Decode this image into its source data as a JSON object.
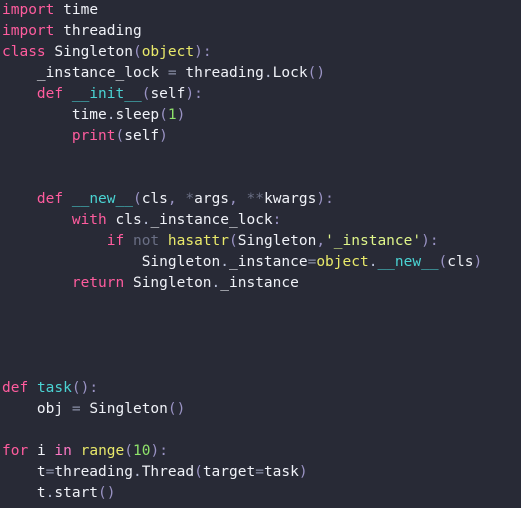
{
  "editor": {
    "language": "Python",
    "theme": "dracula-dark",
    "background_color": "#282a36",
    "font_size_px": 14.5,
    "line_height_px": 21,
    "total_lines": 24
  },
  "colors": {
    "keyword": "#ff5c9e",
    "keyword_in": "#ff79c6",
    "soft_keyword": "#6a6f85",
    "identifier": "#f0f2f8",
    "builtin": "#e9e96a",
    "function_name": "#4ad3d3",
    "number": "#8fe36b",
    "string": "#dff58a",
    "punctuation": "#9a93c4",
    "operator": "#8a8fa6",
    "background": "#282a36"
  },
  "lines": [
    {
      "n": 1,
      "text": "import time",
      "tokens": [
        {
          "t": "import",
          "c": "tok-kw"
        },
        {
          "t": " ",
          "c": "tok-plain"
        },
        {
          "t": "time",
          "c": "tok-plain"
        }
      ]
    },
    {
      "n": 2,
      "text": "import threading",
      "tokens": [
        {
          "t": "import",
          "c": "tok-kw"
        },
        {
          "t": " ",
          "c": "tok-plain"
        },
        {
          "t": "threading",
          "c": "tok-plain"
        }
      ]
    },
    {
      "n": 3,
      "text": "class Singleton(object):",
      "tokens": [
        {
          "t": "class",
          "c": "tok-kw"
        },
        {
          "t": " ",
          "c": "tok-plain"
        },
        {
          "t": "Singleton",
          "c": "tok-plain"
        },
        {
          "t": "(",
          "c": "tok-punct"
        },
        {
          "t": "object",
          "c": "tok-builtin"
        },
        {
          "t": ")",
          "c": "tok-punct"
        },
        {
          "t": ":",
          "c": "tok-punct"
        }
      ]
    },
    {
      "n": 4,
      "text": "    _instance_lock = threading.Lock()",
      "tokens": [
        {
          "t": "    ",
          "c": "tok-plain"
        },
        {
          "t": "_instance_lock",
          "c": "tok-plain"
        },
        {
          "t": " ",
          "c": "tok-plain"
        },
        {
          "t": "=",
          "c": "tok-op"
        },
        {
          "t": " ",
          "c": "tok-plain"
        },
        {
          "t": "threading",
          "c": "tok-plain"
        },
        {
          "t": ".",
          "c": "tok-dot"
        },
        {
          "t": "Lock",
          "c": "tok-plain"
        },
        {
          "t": "(",
          "c": "tok-punct"
        },
        {
          "t": ")",
          "c": "tok-punct"
        }
      ]
    },
    {
      "n": 5,
      "text": "    def __init__(self):",
      "tokens": [
        {
          "t": "    ",
          "c": "tok-plain"
        },
        {
          "t": "def",
          "c": "tok-kw"
        },
        {
          "t": " ",
          "c": "tok-plain"
        },
        {
          "t": "__init__",
          "c": "tok-func"
        },
        {
          "t": "(",
          "c": "tok-punct"
        },
        {
          "t": "self",
          "c": "tok-plain"
        },
        {
          "t": ")",
          "c": "tok-punct"
        },
        {
          "t": ":",
          "c": "tok-punct"
        }
      ]
    },
    {
      "n": 6,
      "text": "        time.sleep(1)",
      "tokens": [
        {
          "t": "        ",
          "c": "tok-plain"
        },
        {
          "t": "time",
          "c": "tok-plain"
        },
        {
          "t": ".",
          "c": "tok-dot"
        },
        {
          "t": "sleep",
          "c": "tok-plain"
        },
        {
          "t": "(",
          "c": "tok-punct"
        },
        {
          "t": "1",
          "c": "tok-num"
        },
        {
          "t": ")",
          "c": "tok-punct"
        }
      ]
    },
    {
      "n": 7,
      "text": "        print(self)",
      "tokens": [
        {
          "t": "        ",
          "c": "tok-plain"
        },
        {
          "t": "print",
          "c": "tok-kw"
        },
        {
          "t": "(",
          "c": "tok-punct"
        },
        {
          "t": "self",
          "c": "tok-plain"
        },
        {
          "t": ")",
          "c": "tok-punct"
        }
      ]
    },
    {
      "n": 8,
      "text": "",
      "tokens": []
    },
    {
      "n": 9,
      "text": "",
      "tokens": []
    },
    {
      "n": 10,
      "text": "    def __new__(cls, *args, **kwargs):",
      "tokens": [
        {
          "t": "    ",
          "c": "tok-plain"
        },
        {
          "t": "def",
          "c": "tok-kw"
        },
        {
          "t": " ",
          "c": "tok-plain"
        },
        {
          "t": "__new__",
          "c": "tok-func"
        },
        {
          "t": "(",
          "c": "tok-punct"
        },
        {
          "t": "cls",
          "c": "tok-plain"
        },
        {
          "t": ",",
          "c": "tok-punct"
        },
        {
          "t": " ",
          "c": "tok-plain"
        },
        {
          "t": "*",
          "c": "tok-op-kw"
        },
        {
          "t": "args",
          "c": "tok-plain"
        },
        {
          "t": ",",
          "c": "tok-punct"
        },
        {
          "t": " ",
          "c": "tok-plain"
        },
        {
          "t": "**",
          "c": "tok-op-kw"
        },
        {
          "t": "kwargs",
          "c": "tok-plain"
        },
        {
          "t": ")",
          "c": "tok-punct"
        },
        {
          "t": ":",
          "c": "tok-punct"
        }
      ]
    },
    {
      "n": 11,
      "text": "        with cls._instance_lock:",
      "tokens": [
        {
          "t": "        ",
          "c": "tok-plain"
        },
        {
          "t": "with",
          "c": "tok-kw"
        },
        {
          "t": " ",
          "c": "tok-plain"
        },
        {
          "t": "cls",
          "c": "tok-plain"
        },
        {
          "t": ".",
          "c": "tok-dot"
        },
        {
          "t": "_instance_lock",
          "c": "tok-plain"
        },
        {
          "t": ":",
          "c": "tok-punct"
        }
      ]
    },
    {
      "n": 12,
      "text": "            if not hasattr(Singleton,'_instance'):",
      "tokens": [
        {
          "t": "            ",
          "c": "tok-plain"
        },
        {
          "t": "if",
          "c": "tok-kw"
        },
        {
          "t": " ",
          "c": "tok-plain"
        },
        {
          "t": "not",
          "c": "tok-op-kw"
        },
        {
          "t": " ",
          "c": "tok-plain"
        },
        {
          "t": "hasattr",
          "c": "tok-builtin"
        },
        {
          "t": "(",
          "c": "tok-punct"
        },
        {
          "t": "Singleton",
          "c": "tok-plain"
        },
        {
          "t": ",",
          "c": "tok-punct"
        },
        {
          "t": "'_instance'",
          "c": "tok-str"
        },
        {
          "t": ")",
          "c": "tok-punct"
        },
        {
          "t": ":",
          "c": "tok-punct"
        }
      ]
    },
    {
      "n": 13,
      "text": "                Singleton._instance=object.__new__(cls)",
      "tokens": [
        {
          "t": "                ",
          "c": "tok-plain"
        },
        {
          "t": "Singleton",
          "c": "tok-plain"
        },
        {
          "t": ".",
          "c": "tok-dot"
        },
        {
          "t": "_instance",
          "c": "tok-plain"
        },
        {
          "t": "=",
          "c": "tok-op"
        },
        {
          "t": "object",
          "c": "tok-builtin"
        },
        {
          "t": ".",
          "c": "tok-dot"
        },
        {
          "t": "__new__",
          "c": "tok-func"
        },
        {
          "t": "(",
          "c": "tok-punct"
        },
        {
          "t": "cls",
          "c": "tok-plain"
        },
        {
          "t": ")",
          "c": "tok-punct"
        }
      ]
    },
    {
      "n": 14,
      "text": "        return Singleton._instance",
      "tokens": [
        {
          "t": "        ",
          "c": "tok-plain"
        },
        {
          "t": "return",
          "c": "tok-kw"
        },
        {
          "t": " ",
          "c": "tok-plain"
        },
        {
          "t": "Singleton",
          "c": "tok-plain"
        },
        {
          "t": ".",
          "c": "tok-dot"
        },
        {
          "t": "_instance",
          "c": "tok-plain"
        }
      ]
    },
    {
      "n": 15,
      "text": "",
      "tokens": []
    },
    {
      "n": 16,
      "text": "",
      "tokens": []
    },
    {
      "n": 17,
      "text": "",
      "tokens": []
    },
    {
      "n": 18,
      "text": "",
      "tokens": []
    },
    {
      "n": 19,
      "text": "def task():",
      "tokens": [
        {
          "t": "def",
          "c": "tok-kw"
        },
        {
          "t": " ",
          "c": "tok-plain"
        },
        {
          "t": "task",
          "c": "tok-func"
        },
        {
          "t": "(",
          "c": "tok-punct"
        },
        {
          "t": ")",
          "c": "tok-punct"
        },
        {
          "t": ":",
          "c": "tok-punct"
        }
      ]
    },
    {
      "n": 20,
      "text": "    obj = Singleton()",
      "tokens": [
        {
          "t": "    ",
          "c": "tok-plain"
        },
        {
          "t": "obj",
          "c": "tok-plain"
        },
        {
          "t": " ",
          "c": "tok-plain"
        },
        {
          "t": "=",
          "c": "tok-op"
        },
        {
          "t": " ",
          "c": "tok-plain"
        },
        {
          "t": "Singleton",
          "c": "tok-plain"
        },
        {
          "t": "(",
          "c": "tok-punct"
        },
        {
          "t": ")",
          "c": "tok-punct"
        }
      ]
    },
    {
      "n": 21,
      "text": "",
      "tokens": []
    },
    {
      "n": 22,
      "text": "for i in range(10):",
      "tokens": [
        {
          "t": "for",
          "c": "tok-kw"
        },
        {
          "t": " ",
          "c": "tok-plain"
        },
        {
          "t": "i",
          "c": "tok-plain"
        },
        {
          "t": " ",
          "c": "tok-plain"
        },
        {
          "t": "in",
          "c": "tok-kw2"
        },
        {
          "t": " ",
          "c": "tok-plain"
        },
        {
          "t": "range",
          "c": "tok-builtin"
        },
        {
          "t": "(",
          "c": "tok-punct"
        },
        {
          "t": "10",
          "c": "tok-num"
        },
        {
          "t": ")",
          "c": "tok-punct"
        },
        {
          "t": ":",
          "c": "tok-punct"
        }
      ]
    },
    {
      "n": 23,
      "text": "    t=threading.Thread(target=task)",
      "tokens": [
        {
          "t": "    ",
          "c": "tok-plain"
        },
        {
          "t": "t",
          "c": "tok-plain"
        },
        {
          "t": "=",
          "c": "tok-op"
        },
        {
          "t": "threading",
          "c": "tok-plain"
        },
        {
          "t": ".",
          "c": "tok-dot"
        },
        {
          "t": "Thread",
          "c": "tok-plain"
        },
        {
          "t": "(",
          "c": "tok-punct"
        },
        {
          "t": "target",
          "c": "tok-plain"
        },
        {
          "t": "=",
          "c": "tok-op"
        },
        {
          "t": "task",
          "c": "tok-plain"
        },
        {
          "t": ")",
          "c": "tok-punct"
        }
      ]
    },
    {
      "n": 24,
      "text": "    t.start()",
      "tokens": [
        {
          "t": "    ",
          "c": "tok-plain"
        },
        {
          "t": "t",
          "c": "tok-plain"
        },
        {
          "t": ".",
          "c": "tok-dot"
        },
        {
          "t": "start",
          "c": "tok-plain"
        },
        {
          "t": "(",
          "c": "tok-punct"
        },
        {
          "t": ")",
          "c": "tok-punct"
        }
      ]
    }
  ]
}
